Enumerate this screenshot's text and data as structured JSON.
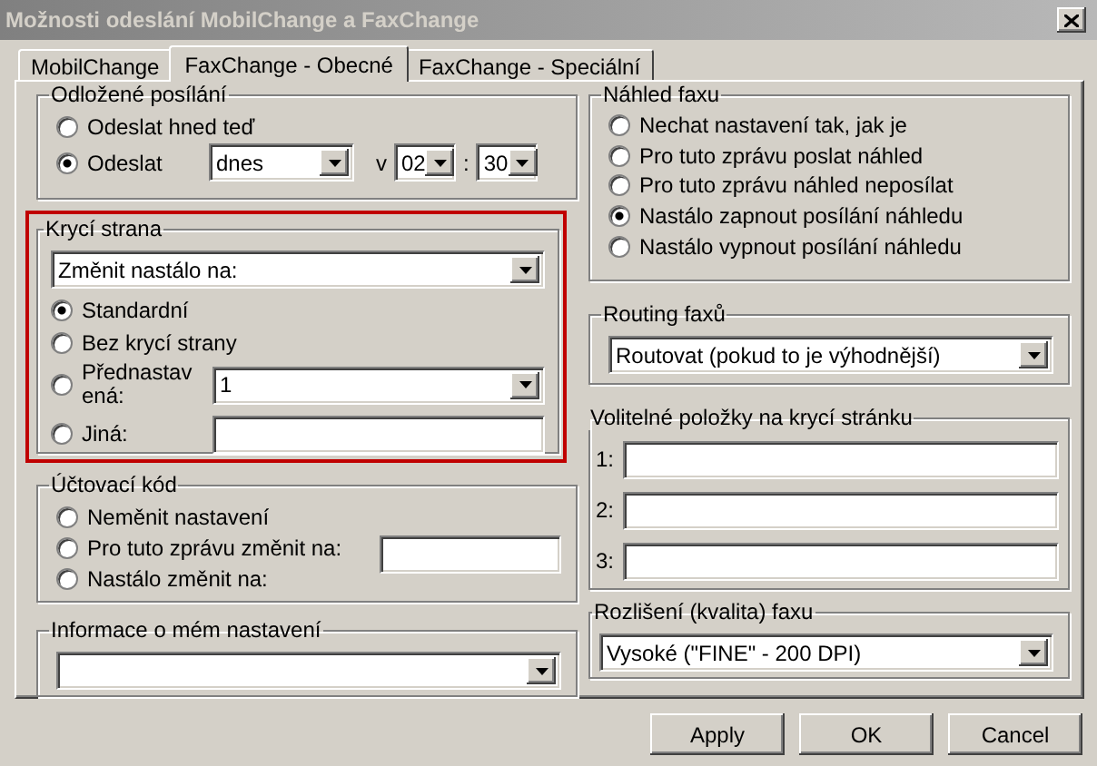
{
  "window": {
    "title": "Možnosti odeslání MobilChange a FaxChange"
  },
  "tabs": [
    {
      "label": "MobilChange",
      "selected": false
    },
    {
      "label": "FaxChange - Obecné",
      "selected": true
    },
    {
      "label": "FaxChange - Speciální",
      "selected": false
    }
  ],
  "delayed_send": {
    "title": "Odložené posílání",
    "options": [
      {
        "label": "Odeslat hned teď",
        "selected": false
      },
      {
        "label": "Odeslat",
        "selected": true
      }
    ],
    "day": "dnes",
    "at_label": "v",
    "hour": "02",
    "separator": ":",
    "minute": "30"
  },
  "cover_page": {
    "title": "Krycí strana",
    "highlighted": true,
    "mode": "Změnit nastálo na:",
    "options": [
      {
        "label": "Standardní",
        "selected": true,
        "kind": "plain"
      },
      {
        "label": "Bez krycí strany",
        "selected": false,
        "kind": "plain"
      },
      {
        "label": "Přednastavená:",
        "selected": false,
        "kind": "select",
        "value": "1"
      },
      {
        "label": "Jiná:",
        "selected": false,
        "kind": "input"
      }
    ]
  },
  "billing_code": {
    "title": "Účtovací kód",
    "options": [
      {
        "label": "Neměnit nastavení",
        "selected": false
      },
      {
        "label": "Pro tuto zprávu změnit na:",
        "selected": false
      },
      {
        "label": "Nastálo změnit na:",
        "selected": false
      }
    ]
  },
  "my_settings": {
    "title": "Informace o mém nastavení"
  },
  "fax_preview": {
    "title": "Náhled faxu",
    "options": [
      {
        "label": "Nechat nastavení tak, jak je",
        "selected": false
      },
      {
        "label": "Pro tuto zprávu poslat náhled",
        "selected": false
      },
      {
        "label": "Pro tuto zprávu náhled neposílat",
        "selected": false
      },
      {
        "label": "Nastálo zapnout posílání náhledu",
        "selected": true
      },
      {
        "label": "Nastálo vypnout posílání náhledu",
        "selected": false
      }
    ]
  },
  "routing": {
    "title": "Routing faxů",
    "value": "Routovat (pokud to je výhodnější)"
  },
  "optional_items": {
    "title": "Volitelné položky na krycí stránku",
    "fields": [
      {
        "label": "1:"
      },
      {
        "label": "2:"
      },
      {
        "label": "3:"
      }
    ]
  },
  "resolution": {
    "title": "Rozlišení (kvalita) faxu",
    "value": "Vysoké (\"FINE\" - 200 DPI)"
  },
  "buttons": [
    "Apply",
    "OK",
    "Cancel"
  ]
}
